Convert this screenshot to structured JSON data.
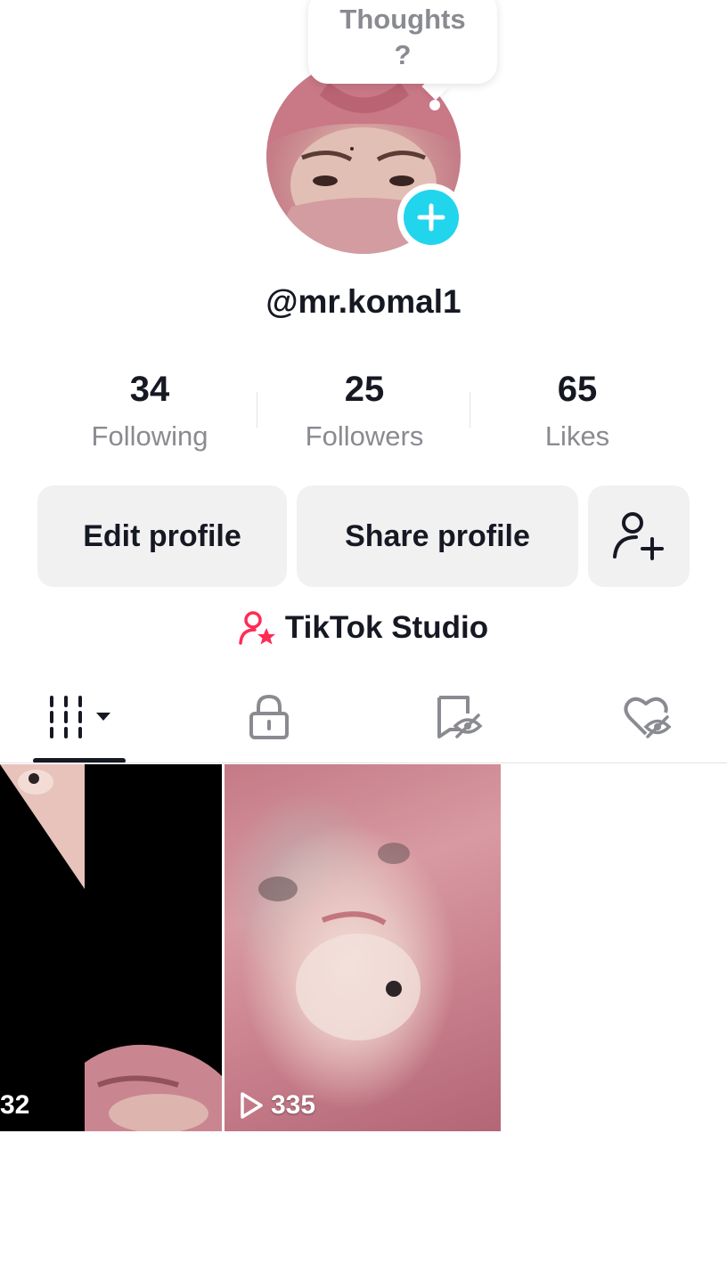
{
  "bubble": {
    "line1": "Thoughts",
    "line2": "?"
  },
  "profile": {
    "username": "@mr.komal1"
  },
  "stats": [
    {
      "value": "34",
      "label": "Following"
    },
    {
      "value": "25",
      "label": "Followers"
    },
    {
      "value": "65",
      "label": "Likes"
    }
  ],
  "buttons": {
    "edit": "Edit profile",
    "share": "Share profile"
  },
  "studio": {
    "label": "TikTok Studio"
  },
  "tabs": [
    "videos-grid-icon",
    "lock-icon",
    "reposts-eye-off-icon",
    "liked-eye-off-icon"
  ],
  "videos": [
    {
      "views": "32"
    },
    {
      "views": "335"
    }
  ],
  "colors": {
    "accent": "#20d5ec",
    "studio_icon": "#fe2c55",
    "text": "#161823",
    "muted": "#8a8b91"
  }
}
